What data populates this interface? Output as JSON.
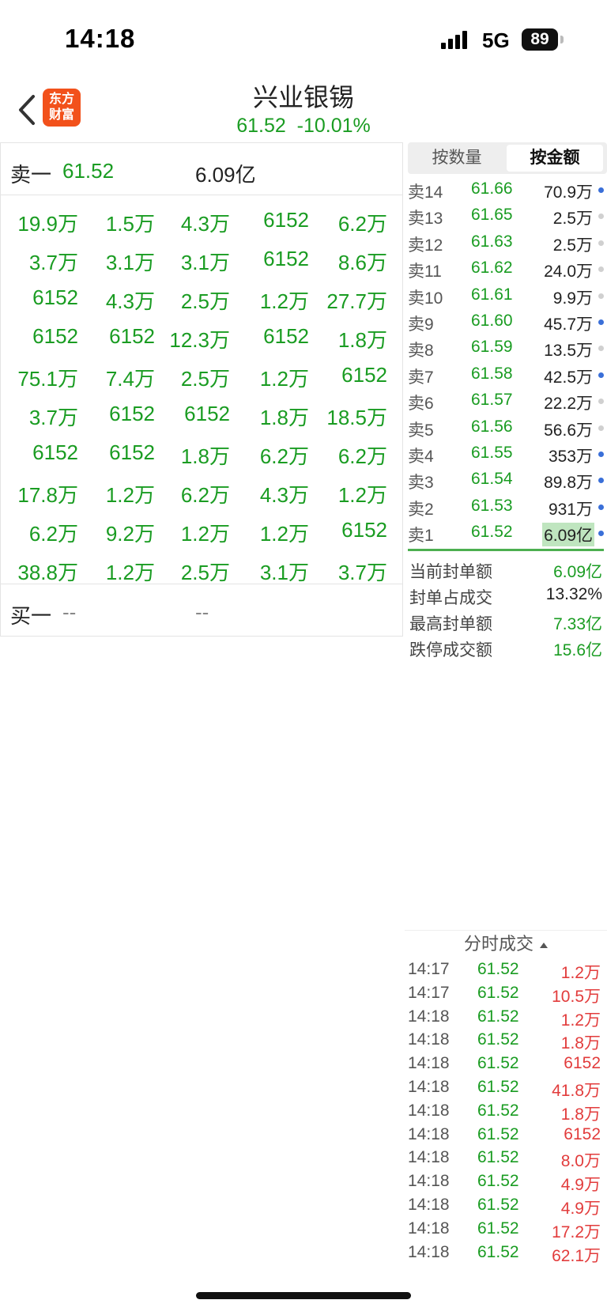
{
  "status_bar": {
    "time": "14:18",
    "network": "5G",
    "battery": "89"
  },
  "header": {
    "logo_line1": "东方",
    "logo_line2": "财富",
    "title": "兴业银锡",
    "price_line": "61.52  -10.01%"
  },
  "ask_level": {
    "label": "卖一",
    "price": "61.52",
    "amount": "6.09亿"
  },
  "queue_grid": [
    [
      "19.9万",
      "1.5万",
      "4.3万",
      "6152",
      "6.2万"
    ],
    [
      "3.7万",
      "3.1万",
      "3.1万",
      "6152",
      "8.6万"
    ],
    [
      "6152",
      "4.3万",
      "2.5万",
      "1.2万",
      "27.7万"
    ],
    [
      "6152",
      "6152",
      "12.3万",
      "6152",
      "1.8万"
    ],
    [
      "75.1万",
      "7.4万",
      "2.5万",
      "1.2万",
      "6152"
    ],
    [
      "3.7万",
      "6152",
      "6152",
      "1.8万",
      "18.5万"
    ],
    [
      "6152",
      "6152",
      "1.8万",
      "6.2万",
      "6.2万"
    ],
    [
      "17.8万",
      "1.2万",
      "6.2万",
      "4.3万",
      "1.2万"
    ],
    [
      "6.2万",
      "9.2万",
      "1.2万",
      "1.2万",
      "6152"
    ],
    [
      "38.8万",
      "1.2万",
      "2.5万",
      "3.1万",
      "3.7万"
    ]
  ],
  "bid_level": {
    "label": "买一",
    "price": "--",
    "amount": "--"
  },
  "tabs": [
    "按数量",
    "按金额"
  ],
  "active_tab": "按金额",
  "order_book": [
    {
      "label": "卖14",
      "price": "61.66",
      "amount": "70.9万",
      "dot": "blue"
    },
    {
      "label": "卖13",
      "price": "61.65",
      "amount": "2.5万",
      "dot": "gray"
    },
    {
      "label": "卖12",
      "price": "61.63",
      "amount": "2.5万",
      "dot": "gray"
    },
    {
      "label": "卖11",
      "price": "61.62",
      "amount": "24.0万",
      "dot": "gray"
    },
    {
      "label": "卖10",
      "price": "61.61",
      "amount": "9.9万",
      "dot": "gray"
    },
    {
      "label": "卖9",
      "price": "61.60",
      "amount": "45.7万",
      "dot": "blue"
    },
    {
      "label": "卖8",
      "price": "61.59",
      "amount": "13.5万",
      "dot": "gray"
    },
    {
      "label": "卖7",
      "price": "61.58",
      "amount": "42.5万",
      "dot": "blue"
    },
    {
      "label": "卖6",
      "price": "61.57",
      "amount": "22.2万",
      "dot": "gray"
    },
    {
      "label": "卖5",
      "price": "61.56",
      "amount": "56.6万",
      "dot": "gray"
    },
    {
      "label": "卖4",
      "price": "61.55",
      "amount": "353万",
      "dot": "blue"
    },
    {
      "label": "卖3",
      "price": "61.54",
      "amount": "89.8万",
      "dot": "blue"
    },
    {
      "label": "卖2",
      "price": "61.53",
      "amount": "931万",
      "dot": "blue"
    },
    {
      "label": "卖1",
      "price": "61.52",
      "amount": "6.09亿",
      "dot": "blue",
      "highlight": true
    }
  ],
  "stats": [
    {
      "label": "当前封单额",
      "value": "6.09亿",
      "color": "#1a9c22"
    },
    {
      "label": "封单占成交",
      "value": "13.32%",
      "color": "#222222"
    },
    {
      "label": "最高封单额",
      "value": "7.33亿",
      "color": "#1a9c22"
    },
    {
      "label": "跌停成交额",
      "value": "15.6亿",
      "color": "#1a9c22"
    }
  ],
  "time_sales": {
    "title": "分时成交",
    "rows": [
      {
        "time": "14:17",
        "price": "61.52",
        "volume": "1.2万"
      },
      {
        "time": "14:17",
        "price": "61.52",
        "volume": "10.5万"
      },
      {
        "time": "14:18",
        "price": "61.52",
        "volume": "1.2万"
      },
      {
        "time": "14:18",
        "price": "61.52",
        "volume": "1.8万"
      },
      {
        "time": "14:18",
        "price": "61.52",
        "volume": "6152"
      },
      {
        "time": "14:18",
        "price": "61.52",
        "volume": "41.8万"
      },
      {
        "time": "14:18",
        "price": "61.52",
        "volume": "1.8万"
      },
      {
        "time": "14:18",
        "price": "61.52",
        "volume": "6152"
      },
      {
        "time": "14:18",
        "price": "61.52",
        "volume": "8.0万"
      },
      {
        "time": "14:18",
        "price": "61.52",
        "volume": "4.9万"
      },
      {
        "time": "14:18",
        "price": "61.52",
        "volume": "4.9万"
      },
      {
        "time": "14:18",
        "price": "61.52",
        "volume": "17.2万"
      },
      {
        "time": "14:18",
        "price": "61.52",
        "volume": "62.1万"
      }
    ]
  },
  "colors": {
    "down_green": "#1a9c22",
    "up_red": "#e23c3c",
    "brand_orange": "#f2511b",
    "highlight_bg": "#bfe5bf"
  },
  "icons": {
    "back": "chevron-left-icon",
    "signal": "cellular-signal-icon",
    "battery": "battery-icon"
  }
}
